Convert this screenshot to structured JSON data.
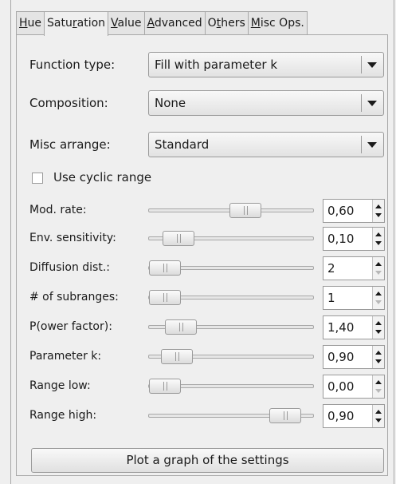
{
  "tabs": [
    {
      "pre": "",
      "u": "H",
      "post": "ue"
    },
    {
      "pre": "Satu",
      "u": "r",
      "post": "ation"
    },
    {
      "pre": "",
      "u": "V",
      "post": "alue"
    },
    {
      "pre": "",
      "u": "A",
      "post": "dvanced"
    },
    {
      "pre": "O",
      "u": "t",
      "post": "hers"
    },
    {
      "pre": "",
      "u": "M",
      "post": "isc Ops."
    }
  ],
  "combos": [
    {
      "label": "Function type:",
      "value": "Fill with parameter k"
    },
    {
      "label": "Composition:",
      "value": "None"
    },
    {
      "label": "Misc arrange:",
      "value": "Standard"
    }
  ],
  "cyclic": {
    "label": "Use cyclic range",
    "checked": false
  },
  "sliders": [
    {
      "label": "Mod. rate:",
      "value": "0,60",
      "position": 0.6,
      "up_disabled": false,
      "down_disabled": false
    },
    {
      "label": "Env. sensitivity:",
      "value": "0,10",
      "position": 0.1,
      "up_disabled": false,
      "down_disabled": false
    },
    {
      "label": "Diffusion dist.:",
      "value": "2",
      "position": 0.0,
      "up_disabled": false,
      "down_disabled": true
    },
    {
      "label": "# of subranges:",
      "value": "1",
      "position": 0.0,
      "up_disabled": false,
      "down_disabled": true
    },
    {
      "label": "P(ower factor):",
      "value": "1,40",
      "position": 0.12,
      "up_disabled": false,
      "down_disabled": false
    },
    {
      "label": "Parameter k:",
      "value": "0,90",
      "position": 0.09,
      "up_disabled": false,
      "down_disabled": false
    },
    {
      "label": "Range low:",
      "value": "0,00",
      "position": 0.0,
      "up_disabled": false,
      "down_disabled": true
    },
    {
      "label": "Range high:",
      "value": "0,90",
      "position": 0.9,
      "up_disabled": false,
      "down_disabled": false
    }
  ],
  "plot_button": "Plot a graph of the settings"
}
